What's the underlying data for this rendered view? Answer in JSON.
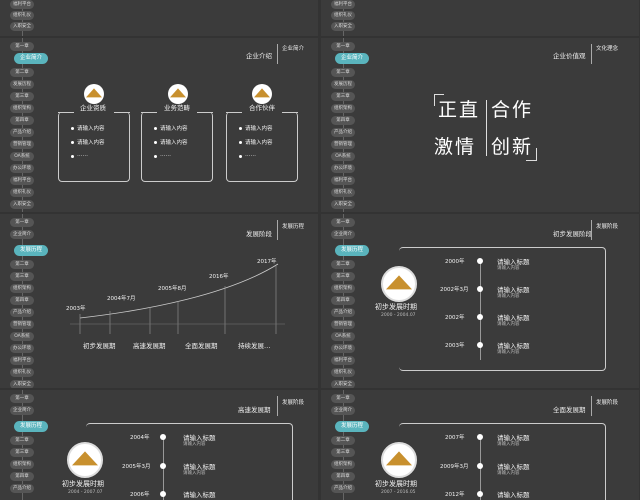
{
  "sidebar": {
    "labels": [
      "第一章",
      "企业简介",
      "第二章",
      "发展历程",
      "第三章",
      "组织架构",
      "第四章",
      "产品介绍",
      "营销管理",
      "OA系统",
      "办公环境",
      "福利平台",
      "组织礼仪",
      "入职安全"
    ],
    "active_company": "企业简介",
    "active_history": "发展历程"
  },
  "slide_intro": {
    "title": "企业介绍",
    "tag": "企业简介",
    "cards": [
      {
        "title": "企业资质",
        "items": [
          "请输入内容",
          "请输入内容",
          "……"
        ]
      },
      {
        "title": "业务范畴",
        "items": [
          "请输入内容",
          "请输入内容",
          "……"
        ]
      },
      {
        "title": "合作伙伴",
        "items": [
          "请输入内容",
          "请输入内容",
          "……"
        ]
      }
    ]
  },
  "slide_values": {
    "title": "企业价值观",
    "tag": "文化理念",
    "words": [
      "正直",
      "合作",
      "激情",
      "创新"
    ]
  },
  "slide_stages": {
    "title": "发展阶段",
    "tag": "发展历程",
    "years": [
      "2003年",
      "2004年7月",
      "2005年8月",
      "2016年",
      "2017年"
    ],
    "phases": [
      "初步发展期",
      "高速发展期",
      "全面发展期",
      "持续发展…"
    ]
  },
  "slide_early": {
    "title": "初步发展阶段",
    "tag": "发展阶段",
    "period": "初步发展时期",
    "range": "2000 - 2004.07",
    "events": [
      {
        "date": "2000年",
        "title": "请输入标题",
        "sub": "请输入内容"
      },
      {
        "date": "2002年3月",
        "title": "请输入标题",
        "sub": "请输入内容"
      },
      {
        "date": "2002年",
        "title": "请输入标题",
        "sub": "请输入内容"
      },
      {
        "date": "2003年",
        "title": "请输入标题",
        "sub": "请输入内容"
      }
    ]
  },
  "slide_fast": {
    "title": "高速发展期",
    "tag": "发展阶段",
    "period": "初步发展时期",
    "range": "2004 - 2007.07",
    "events": [
      {
        "date": "2004年",
        "title": "请输入标题",
        "sub": "请输入内容"
      },
      {
        "date": "2005年3月",
        "title": "请输入标题",
        "sub": "请输入内容"
      },
      {
        "date": "2006年",
        "title": "请输入标题",
        "sub": "请输入内容"
      }
    ]
  },
  "slide_full": {
    "title": "全面发展期",
    "tag": "发展阶段",
    "period": "初步发展时期",
    "range": "2007 - 2016.05",
    "events": [
      {
        "date": "2007年",
        "title": "请输入标题",
        "sub": "请输入内容"
      },
      {
        "date": "2009年3月",
        "title": "请输入标题",
        "sub": "请输入内容"
      },
      {
        "date": "2012年",
        "title": "请输入标题",
        "sub": "请输入内容"
      }
    ]
  }
}
